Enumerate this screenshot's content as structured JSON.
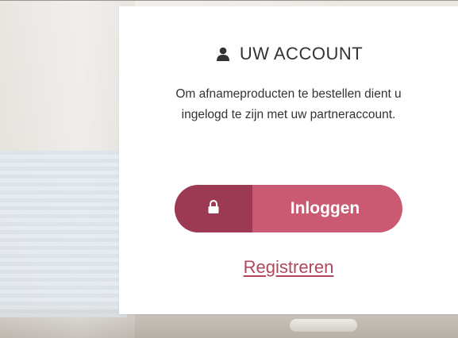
{
  "account_panel": {
    "title": "UW ACCOUNT",
    "description": "Om afnameproducten te bestellen dient u ingelogd te zijn met uw partneraccount.",
    "login_button": {
      "label": "Inloggen",
      "icon": "lock-icon"
    },
    "register_link": "Registreren",
    "header_icon": "user-icon"
  },
  "colors": {
    "button_main": "#c95a72",
    "button_icon_bg": "#9b3a52",
    "link": "#b3455d",
    "text": "#333333"
  }
}
